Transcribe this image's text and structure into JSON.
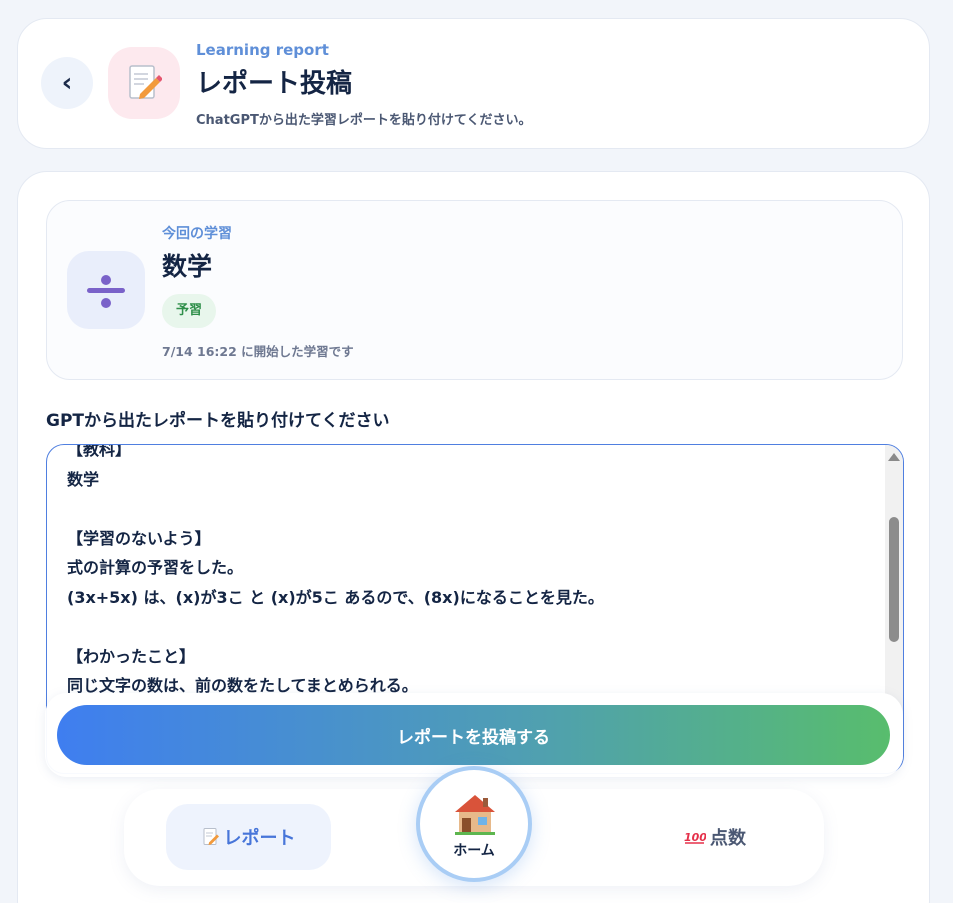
{
  "header": {
    "kicker": "Learning report",
    "title": "レポート投稿",
    "subtitle": "ChatGPTから出た学習レポートを貼り付けてください。",
    "back_label": "‹"
  },
  "study": {
    "kicker": "今回の学習",
    "subject": "数学",
    "tag": "予習",
    "started": "7/14 16:22 に開始した学習です"
  },
  "form": {
    "label": "GPTから出たレポートを貼り付けてください",
    "report_text": "【教科】\n数学\n\n【学習のないよう】\n式の計算の予習をした。\n(3x+5x) は、(x)が3こ と (x)が5こ あるので、(8x)になることを見た。\n\n【わかったこと】\n同じ文字の数は、前の数をたしてまとめられる。",
    "submit_label": "レポートを投稿する"
  },
  "nav": {
    "report_label": "レポート",
    "home_label": "ホーム",
    "score_label": "点数",
    "score_icon_text": "100"
  },
  "icons": {
    "back": "chevron-left-icon",
    "header": "memo-icon",
    "subject": "division-icon",
    "home": "house-icon",
    "score": "hundred-points-icon"
  },
  "colors": {
    "accent": "#4f7fe0",
    "gradient_start": "#3f7ef0",
    "gradient_end": "#58bd6d",
    "tag_text": "#2f8f4a"
  }
}
